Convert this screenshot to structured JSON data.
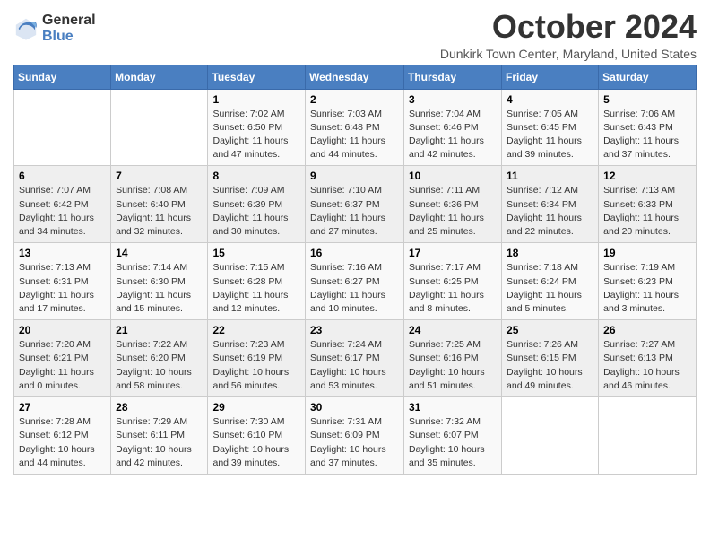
{
  "logo": {
    "general": "General",
    "blue": "Blue"
  },
  "title": "October 2024",
  "location": "Dunkirk Town Center, Maryland, United States",
  "days_of_week": [
    "Sunday",
    "Monday",
    "Tuesday",
    "Wednesday",
    "Thursday",
    "Friday",
    "Saturday"
  ],
  "weeks": [
    [
      {
        "day": "",
        "info": ""
      },
      {
        "day": "",
        "info": ""
      },
      {
        "day": "1",
        "info": "Sunrise: 7:02 AM\nSunset: 6:50 PM\nDaylight: 11 hours and 47 minutes."
      },
      {
        "day": "2",
        "info": "Sunrise: 7:03 AM\nSunset: 6:48 PM\nDaylight: 11 hours and 44 minutes."
      },
      {
        "day": "3",
        "info": "Sunrise: 7:04 AM\nSunset: 6:46 PM\nDaylight: 11 hours and 42 minutes."
      },
      {
        "day": "4",
        "info": "Sunrise: 7:05 AM\nSunset: 6:45 PM\nDaylight: 11 hours and 39 minutes."
      },
      {
        "day": "5",
        "info": "Sunrise: 7:06 AM\nSunset: 6:43 PM\nDaylight: 11 hours and 37 minutes."
      }
    ],
    [
      {
        "day": "6",
        "info": "Sunrise: 7:07 AM\nSunset: 6:42 PM\nDaylight: 11 hours and 34 minutes."
      },
      {
        "day": "7",
        "info": "Sunrise: 7:08 AM\nSunset: 6:40 PM\nDaylight: 11 hours and 32 minutes."
      },
      {
        "day": "8",
        "info": "Sunrise: 7:09 AM\nSunset: 6:39 PM\nDaylight: 11 hours and 30 minutes."
      },
      {
        "day": "9",
        "info": "Sunrise: 7:10 AM\nSunset: 6:37 PM\nDaylight: 11 hours and 27 minutes."
      },
      {
        "day": "10",
        "info": "Sunrise: 7:11 AM\nSunset: 6:36 PM\nDaylight: 11 hours and 25 minutes."
      },
      {
        "day": "11",
        "info": "Sunrise: 7:12 AM\nSunset: 6:34 PM\nDaylight: 11 hours and 22 minutes."
      },
      {
        "day": "12",
        "info": "Sunrise: 7:13 AM\nSunset: 6:33 PM\nDaylight: 11 hours and 20 minutes."
      }
    ],
    [
      {
        "day": "13",
        "info": "Sunrise: 7:13 AM\nSunset: 6:31 PM\nDaylight: 11 hours and 17 minutes."
      },
      {
        "day": "14",
        "info": "Sunrise: 7:14 AM\nSunset: 6:30 PM\nDaylight: 11 hours and 15 minutes."
      },
      {
        "day": "15",
        "info": "Sunrise: 7:15 AM\nSunset: 6:28 PM\nDaylight: 11 hours and 12 minutes."
      },
      {
        "day": "16",
        "info": "Sunrise: 7:16 AM\nSunset: 6:27 PM\nDaylight: 11 hours and 10 minutes."
      },
      {
        "day": "17",
        "info": "Sunrise: 7:17 AM\nSunset: 6:25 PM\nDaylight: 11 hours and 8 minutes."
      },
      {
        "day": "18",
        "info": "Sunrise: 7:18 AM\nSunset: 6:24 PM\nDaylight: 11 hours and 5 minutes."
      },
      {
        "day": "19",
        "info": "Sunrise: 7:19 AM\nSunset: 6:23 PM\nDaylight: 11 hours and 3 minutes."
      }
    ],
    [
      {
        "day": "20",
        "info": "Sunrise: 7:20 AM\nSunset: 6:21 PM\nDaylight: 11 hours and 0 minutes."
      },
      {
        "day": "21",
        "info": "Sunrise: 7:22 AM\nSunset: 6:20 PM\nDaylight: 10 hours and 58 minutes."
      },
      {
        "day": "22",
        "info": "Sunrise: 7:23 AM\nSunset: 6:19 PM\nDaylight: 10 hours and 56 minutes."
      },
      {
        "day": "23",
        "info": "Sunrise: 7:24 AM\nSunset: 6:17 PM\nDaylight: 10 hours and 53 minutes."
      },
      {
        "day": "24",
        "info": "Sunrise: 7:25 AM\nSunset: 6:16 PM\nDaylight: 10 hours and 51 minutes."
      },
      {
        "day": "25",
        "info": "Sunrise: 7:26 AM\nSunset: 6:15 PM\nDaylight: 10 hours and 49 minutes."
      },
      {
        "day": "26",
        "info": "Sunrise: 7:27 AM\nSunset: 6:13 PM\nDaylight: 10 hours and 46 minutes."
      }
    ],
    [
      {
        "day": "27",
        "info": "Sunrise: 7:28 AM\nSunset: 6:12 PM\nDaylight: 10 hours and 44 minutes."
      },
      {
        "day": "28",
        "info": "Sunrise: 7:29 AM\nSunset: 6:11 PM\nDaylight: 10 hours and 42 minutes."
      },
      {
        "day": "29",
        "info": "Sunrise: 7:30 AM\nSunset: 6:10 PM\nDaylight: 10 hours and 39 minutes."
      },
      {
        "day": "30",
        "info": "Sunrise: 7:31 AM\nSunset: 6:09 PM\nDaylight: 10 hours and 37 minutes."
      },
      {
        "day": "31",
        "info": "Sunrise: 7:32 AM\nSunset: 6:07 PM\nDaylight: 10 hours and 35 minutes."
      },
      {
        "day": "",
        "info": ""
      },
      {
        "day": "",
        "info": ""
      }
    ]
  ]
}
